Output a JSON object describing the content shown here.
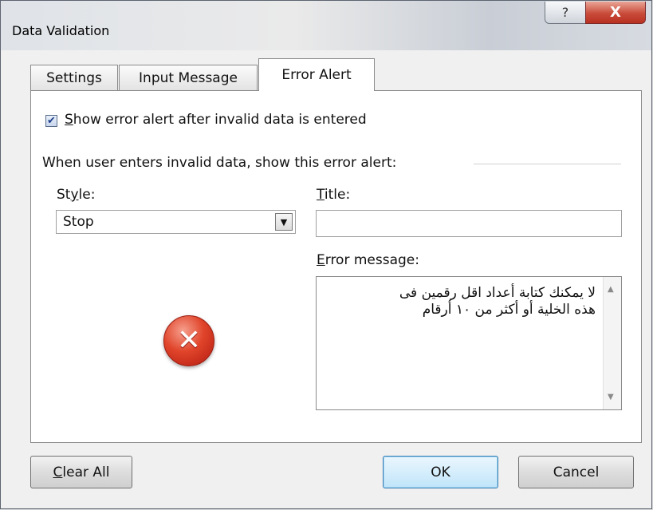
{
  "window": {
    "title": "Data Validation",
    "help_label": "?",
    "close_label": "X"
  },
  "tabs": [
    {
      "label": "Settings",
      "active": false
    },
    {
      "label": "Input Message",
      "active": false
    },
    {
      "label": "Error Alert",
      "active": true
    }
  ],
  "error_alert": {
    "show_alert_checked": true,
    "show_alert_label_mnemonic": "S",
    "show_alert_label_rest": "how error alert after invalid data is entered",
    "group_label": "When user enters invalid data, show this error alert:",
    "style_label_pre": "St",
    "style_label_mnemonic": "y",
    "style_label_post": "le:",
    "style_value": "Stop",
    "title_label_mnemonic": "T",
    "title_label_rest": "itle:",
    "title_value": "",
    "message_label_mnemonic": "E",
    "message_label_rest": "rror message:",
    "message_value": "لا يمكنك كتابة أعداد اقل رقمين فى\nهذه الخلية أو أكثر من ١٠ أرقام",
    "stop_icon": "stop-error-icon"
  },
  "buttons": {
    "clear_all_mnemonic": "C",
    "clear_all_rest": "lear All",
    "ok": "OK",
    "cancel": "Cancel"
  },
  "colors": {
    "close_button": "#c94b3a",
    "stop_icon": "#e0442a",
    "default_button_border": "#3c7fb1"
  }
}
